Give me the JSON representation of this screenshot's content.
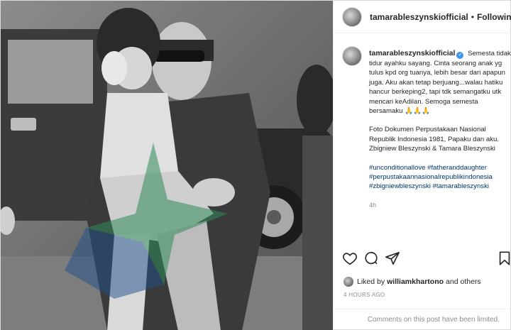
{
  "header": {
    "username": "tamarableszynskiofficial",
    "username_display": "tamarableszynskiofficial",
    "separator": "•",
    "follow_status": "Following"
  },
  "caption": {
    "username": "tamarableszynskiofficial",
    "verified_mark": "✓",
    "text_1": "Semesta tidak tidur ayahku sayang. Cinta seorang anak yg tulus kpd org tuanya, lebih besar dari apapun juga. Aku akan tetap berjuang...walau hatiku hancur berkeping2, tapi tdk semangatku utk mencari keAdilan. Semoga semesta bersamaku 🙏🙏🙏",
    "text_2": "Foto Dokumen Perpustakaan Nasional Republik Indonesia 1981, Papaku dan aku.",
    "text_3": "Zbigniew Bleszynski & Tamara Bleszynski",
    "hashtags": [
      "#unconditionallove #fatheranddaughter",
      "#perpustakaannasionalrepublikindonesia",
      "#zbigniewbleszynski #tamarableszynski"
    ],
    "time_ago": "4h"
  },
  "icons": {
    "like": "heart-icon",
    "comment": "comment-icon",
    "share": "share-icon",
    "save": "bookmark-icon"
  },
  "likes": {
    "prefix": "Liked by",
    "user": "williamkhartono",
    "suffix": "and others"
  },
  "timestamp": "4 HOURS AGO",
  "comments_notice": "Comments on this post have been limited.",
  "colors": {
    "link": "#00376b",
    "muted": "#8e8e8e",
    "verified": "#3897f0",
    "border": "#dbdbdb"
  }
}
